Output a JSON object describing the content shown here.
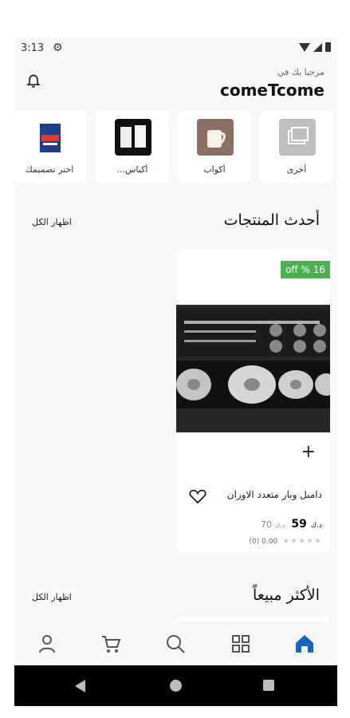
{
  "status": {
    "time": "3:13"
  },
  "header": {
    "welcome": "مرحبا بك في",
    "brand": "comeTcome"
  },
  "categories": [
    {
      "label": "أخرى"
    },
    {
      "label": "أكواب"
    },
    {
      "label": "أكياس..."
    },
    {
      "label": "اختر تصميمك"
    }
  ],
  "latest": {
    "title": "أحدث المنتجات",
    "show_all": "اظهار الكل"
  },
  "product": {
    "discount": "off % 16",
    "name": "دامبل وبار متعدد الاوزان",
    "price": "59",
    "currency": "د.ك",
    "old_price": "70",
    "rating": "(0) 0.00",
    "stars": "★★★★★"
  },
  "bestsellers": {
    "title": "الأكثر مبيعاً",
    "show_all": "اظهار الكل"
  },
  "nav": [
    "profile",
    "cart",
    "search",
    "categories",
    "home"
  ],
  "colors": {
    "accent": "#1565c0",
    "discount": "#4caf50"
  }
}
